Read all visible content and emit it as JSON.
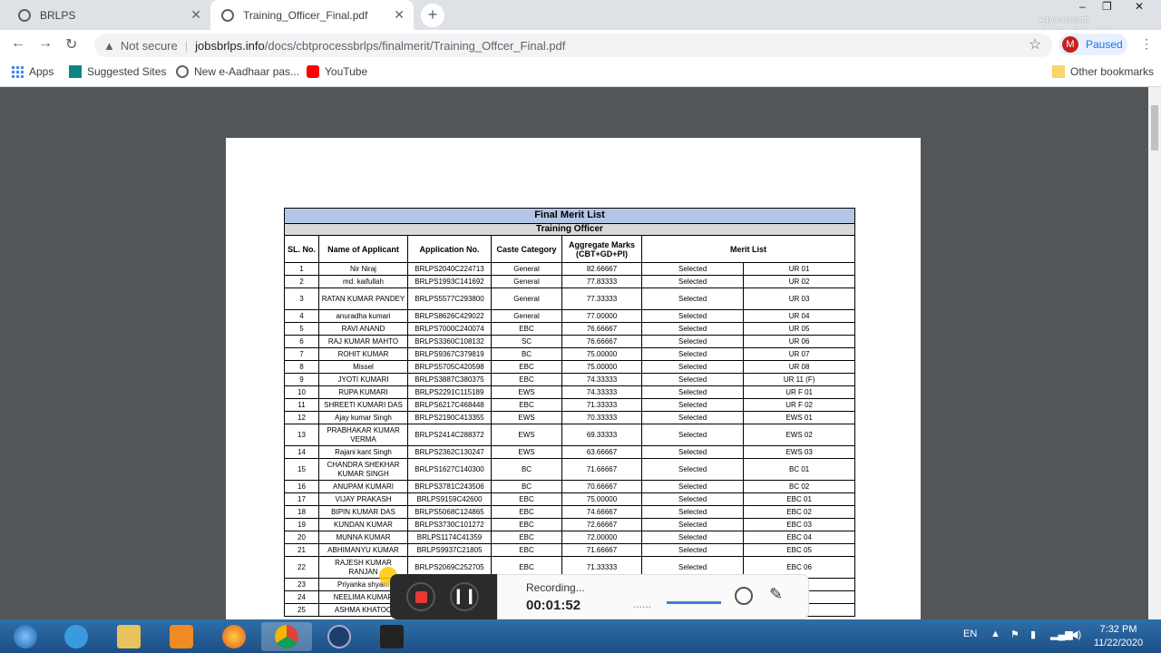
{
  "tabs": [
    {
      "title": "BRLPS"
    },
    {
      "title": "Training_Officer_Final.pdf"
    }
  ],
  "window": {
    "minimize": "–",
    "maximize": "❐",
    "close": "✕"
  },
  "address": {
    "security": "Not secure",
    "host": "jobsbrlps.info",
    "path": "/docs/cbtprocessbrlps/finalmerit/Training_Offcer_Final.pdf"
  },
  "profile": {
    "initial": "M",
    "status": "Paused"
  },
  "bookmarks": {
    "items": [
      "Apps",
      "Suggested Sites",
      "New e-Aadhaar pas...",
      "YouTube"
    ],
    "other": "Other bookmarks"
  },
  "pdf": {
    "title": "Final Merit List",
    "subtitle": "Training Officer",
    "headers": {
      "sl": "SL. No.",
      "name": "Name of Applicant",
      "app": "Application No.",
      "caste": "Caste Category",
      "marks": "Aggregate Marks (CBT+GD+PI)",
      "merit": "Merit List"
    },
    "rows": [
      [
        "1",
        "Nir Niraj",
        "BRLPS2040C224713",
        "General",
        "82.66667",
        "Selected",
        "UR 01"
      ],
      [
        "2",
        "md. kaifullah",
        "BRLPS1993C141692",
        "General",
        "77.83333",
        "Selected",
        "UR 02"
      ],
      [
        "3",
        "RATAN KUMAR PANDEY",
        "BRLPS5577C293800",
        "General",
        "77.33333",
        "Selected",
        "UR 03"
      ],
      [
        "4",
        "anuradha kumari",
        "BRLPS8626C429022",
        "General",
        "77.00000",
        "Selected",
        "UR 04"
      ],
      [
        "5",
        "RAVI ANAND",
        "BRLPS7000C240074",
        "EBC",
        "76.66667",
        "Selected",
        "UR 05"
      ],
      [
        "6",
        "RAJ KUMAR MAHTO",
        "BRLPS3360C108132",
        "SC",
        "76.66667",
        "Selected",
        "UR 06"
      ],
      [
        "7",
        "ROHIT KUMAR",
        "BRLPS9367C379819",
        "BC",
        "75.00000",
        "Selected",
        "UR 07"
      ],
      [
        "8",
        "Missel",
        "BRLPS5705C420598",
        "EBC",
        "75.00000",
        "Selected",
        "UR 08"
      ],
      [
        "9",
        "JYOTI KUMARI",
        "BRLPS3887C380375",
        "EBC",
        "74.33333",
        "Selected",
        "UR 11 (F)"
      ],
      [
        "10",
        "RUPA KUMARI",
        "BRLPS2291C115189",
        "EWS",
        "74.33333",
        "Selected",
        "UR F 01"
      ],
      [
        "11",
        "SHREETI KUMARI DAS",
        "BRLPS6217C468448",
        "EBC",
        "71.33333",
        "Selected",
        "UR F 02"
      ],
      [
        "12",
        "Ajay kumar Singh",
        "BRLPS2190C413355",
        "EWS",
        "70.33333",
        "Selected",
        "EWS 01"
      ],
      [
        "13",
        "PRABHAKAR KUMAR VERMA",
        "BRLPS2414C288372",
        "EWS",
        "69.33333",
        "Selected",
        "EWS 02"
      ],
      [
        "14",
        "Rajani kant Singh",
        "BRLPS2362C130247",
        "EWS",
        "63.66667",
        "Selected",
        "EWS 03"
      ],
      [
        "15",
        "CHANDRA SHEKHAR KUMAR SINGH",
        "BRLPS1627C140300",
        "BC",
        "71.66667",
        "Selected",
        "BC 01"
      ],
      [
        "16",
        "ANUPAM KUMARI",
        "BRLPS3781C243506",
        "BC",
        "70.66667",
        "Selected",
        "BC 02"
      ],
      [
        "17",
        "VIJAY PRAKASH",
        "BRLPS9159C42600",
        "EBC",
        "75.00000",
        "Selected",
        "EBC 01"
      ],
      [
        "18",
        "BIPIN KUMAR DAS",
        "BRLPS5068C124865",
        "EBC",
        "74.66667",
        "Selected",
        "EBC 02"
      ],
      [
        "19",
        "KUNDAN KUMAR",
        "BRLPS3730C101272",
        "EBC",
        "72.66667",
        "Selected",
        "EBC 03"
      ],
      [
        "20",
        "MUNNA KUMAR",
        "BRLPS1174C41359",
        "EBC",
        "72.00000",
        "Selected",
        "EBC 04"
      ],
      [
        "21",
        "ABHIMANYU KUMAR",
        "BRLPS9937C21805",
        "EBC",
        "71.66667",
        "Selected",
        "EBC 05"
      ],
      [
        "22",
        "RAJESH KUMAR RANJAN",
        "BRLPS2069C252705",
        "EBC",
        "71.33333",
        "Selected",
        "EBC 06"
      ],
      [
        "23",
        "Priyanka shyam",
        "",
        "",
        "",
        "",
        ""
      ],
      [
        "24",
        "NEELIMA KUMAR",
        "",
        "",
        "",
        "",
        ""
      ],
      [
        "25",
        "ASHMA KHATOO",
        "",
        "",
        "",
        "",
        ""
      ]
    ]
  },
  "recorder": {
    "status": "Recording...",
    "time": "00:01:52",
    "dots": "......"
  },
  "watermark": {
    "line1": "Apowersoft",
    "line2": "Screen Recorder"
  },
  "taskbar": {
    "lang": "EN",
    "time": "7:32 PM",
    "date": "11/22/2020"
  },
  "colors": {
    "title_band": "#b4c6e7",
    "subtitle_band": "#d9d9d9",
    "taskbar": "#2f6ea8",
    "stop": "#e53935"
  }
}
